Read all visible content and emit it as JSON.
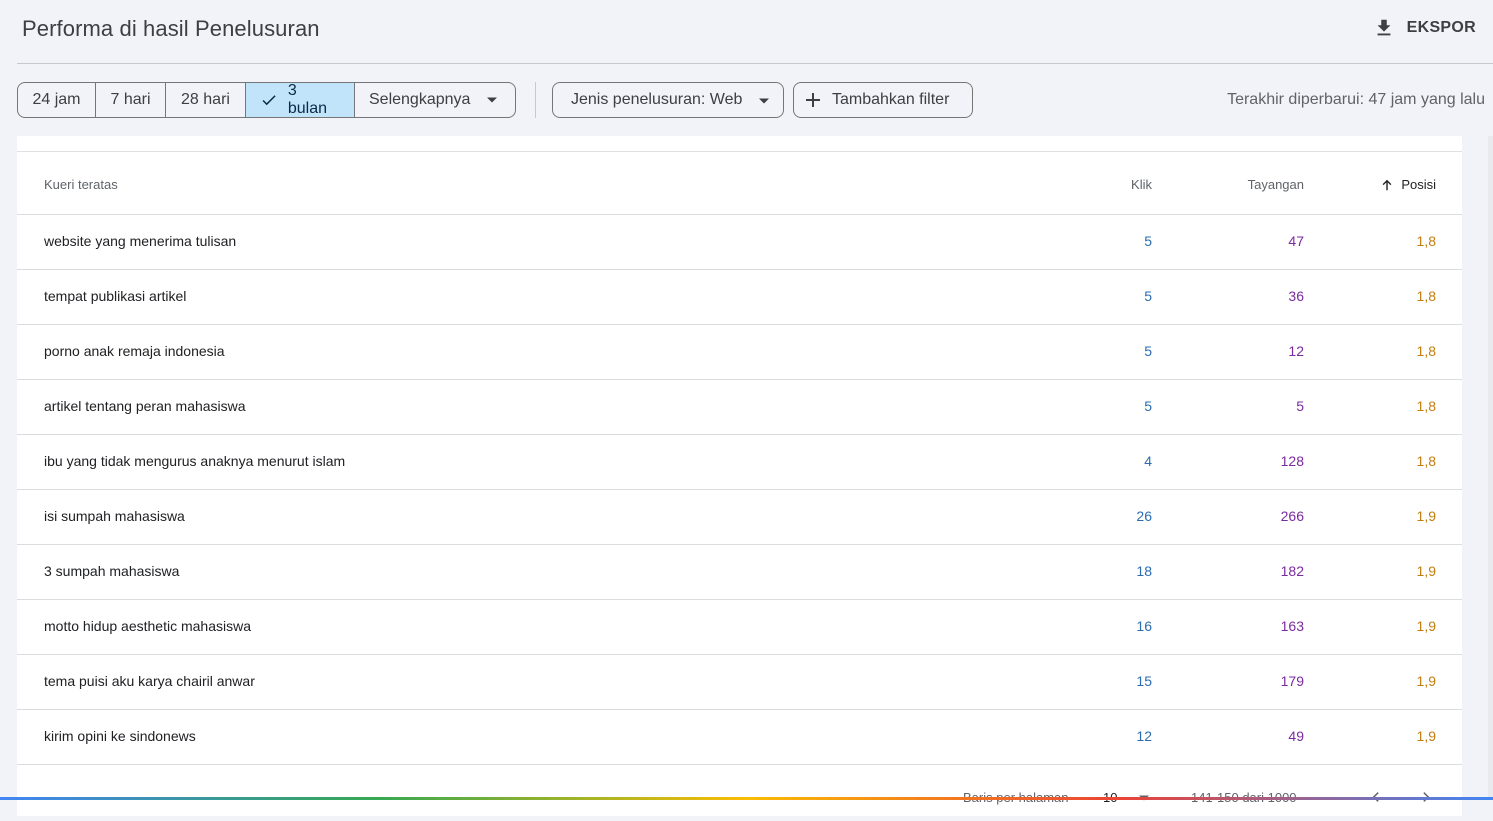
{
  "header": {
    "title": "Performa di hasil Penelusuran",
    "export_label": "EKSPOR"
  },
  "toolbar": {
    "date_ranges": [
      "24 jam",
      "7 hari",
      "28 hari",
      "3 bulan",
      "Selengkapnya"
    ],
    "selected_range": "3 bulan",
    "search_type_label": "Jenis penelusuran: Web",
    "add_filter_label": "Tambahkan filter",
    "last_updated": "Terakhir diperbarui: 47 jam yang lalu"
  },
  "table": {
    "headers": {
      "query": "Kueri teratas",
      "clicks": "Klik",
      "impressions": "Tayangan",
      "position": "Posisi"
    },
    "sort": {
      "column": "position",
      "direction": "ascending"
    },
    "rows": [
      {
        "query": "website yang menerima tulisan",
        "clicks": "5",
        "impressions": "47",
        "position": "1,8"
      },
      {
        "query": "tempat publikasi artikel",
        "clicks": "5",
        "impressions": "36",
        "position": "1,8"
      },
      {
        "query": "porno anak remaja indonesia",
        "clicks": "5",
        "impressions": "12",
        "position": "1,8"
      },
      {
        "query": "artikel tentang peran mahasiswa",
        "clicks": "5",
        "impressions": "5",
        "position": "1,8"
      },
      {
        "query": "ibu yang tidak mengurus anaknya menurut islam",
        "clicks": "4",
        "impressions": "128",
        "position": "1,8"
      },
      {
        "query": "isi sumpah mahasiswa",
        "clicks": "26",
        "impressions": "266",
        "position": "1,9"
      },
      {
        "query": "3 sumpah mahasiswa",
        "clicks": "18",
        "impressions": "182",
        "position": "1,9"
      },
      {
        "query": "motto hidup aesthetic mahasiswa",
        "clicks": "16",
        "impressions": "163",
        "position": "1,9"
      },
      {
        "query": "tema puisi aku karya chairil anwar",
        "clicks": "15",
        "impressions": "179",
        "position": "1,9"
      },
      {
        "query": "kirim opini ke sindonews",
        "clicks": "12",
        "impressions": "49",
        "position": "1,9"
      }
    ]
  },
  "pagination": {
    "rows_per_page_label": "Baris per halaman",
    "rows_per_page_value": "10",
    "range_label": "141-150 dari 1000"
  },
  "colors": {
    "clicks": "#2b6cb0",
    "impressions": "#7b2a9f",
    "position": "#c27d10",
    "selected_chip": "#c2e4fb"
  },
  "icons": [
    "download-icon",
    "check-icon",
    "caret-down-icon",
    "plus-icon",
    "arrow-up-icon",
    "chevron-left-icon",
    "chevron-right-icon"
  ]
}
